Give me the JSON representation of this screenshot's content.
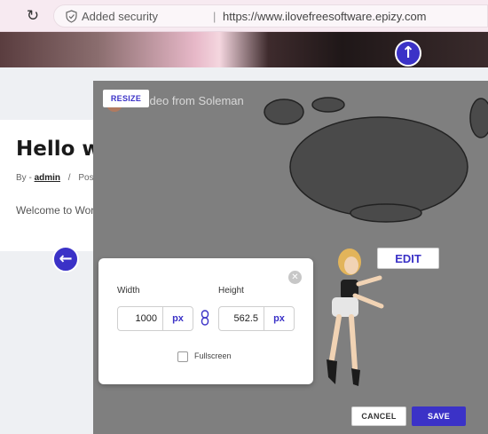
{
  "browser": {
    "security_label": "Added security",
    "divider": "|",
    "url": "https://www.ilovefreesoftware.epizy.com"
  },
  "post": {
    "title": "Hello wo",
    "meta_prefix": "By - ",
    "author": "admin",
    "meta_sep": "/",
    "meta_rest": "Post",
    "excerpt": "Welcome to Wor"
  },
  "overlay": {
    "video_title": "t Video from Soleman",
    "resize_label": "RESIZE",
    "edit_label": "EDIT",
    "cancel_label": "CANCEL",
    "save_label": "SAVE"
  },
  "dialog": {
    "close_symbol": "✕",
    "width_label": "Width",
    "width_value": "1000",
    "width_unit": "px",
    "height_label": "Height",
    "height_value": "562.5",
    "height_unit": "px",
    "fullscreen_label": "Fullscreen",
    "fullscreen_checked": false
  },
  "icons": {
    "reload": "reload-icon",
    "shield": "shield-icon",
    "up": "arrow-up-icon",
    "left": "arrow-left-icon",
    "link": "link-icon"
  },
  "colors": {
    "accent": "#3b32c7",
    "browser_bar": "#f7eaf1",
    "overlay": "#7f7f7f"
  }
}
